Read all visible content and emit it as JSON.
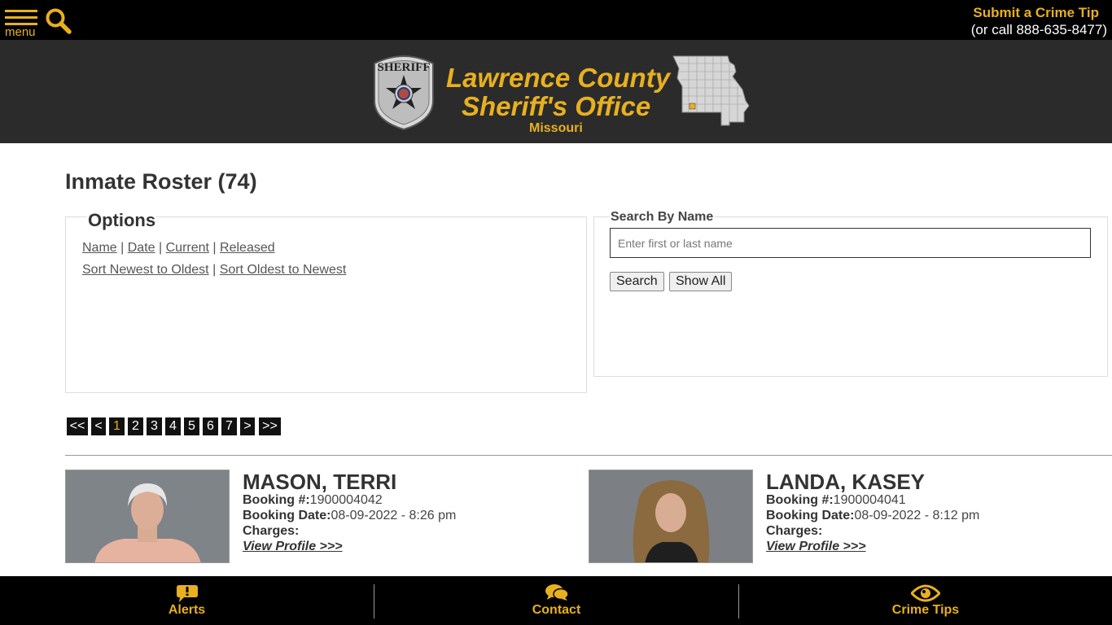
{
  "header": {
    "menu_label": "menu",
    "tip_title": "Submit a Crime Tip",
    "tip_phone": "(or call 888-635-8477)"
  },
  "banner": {
    "badge_text": "SHERIFF",
    "line1": "Lawrence County",
    "line2": "Sheriff's Office",
    "state": "Missouri"
  },
  "page": {
    "title": "Inmate Roster (74)"
  },
  "options": {
    "legend": "Options",
    "sort_links": [
      "Name",
      "Date",
      "Current",
      "Released"
    ],
    "order_links": [
      "Sort Newest to Oldest",
      "Sort Oldest to Newest"
    ],
    "separator": "|"
  },
  "search": {
    "legend": "Search By Name",
    "placeholder": "Enter first or last name",
    "search_button": "Search",
    "show_all_button": "Show All"
  },
  "pagination": [
    "<<",
    "<",
    "1",
    "2",
    "3",
    "4",
    "5",
    "6",
    "7",
    ">",
    ">>"
  ],
  "pagination_active": "1",
  "inmates": [
    {
      "name": "MASON, TERRI",
      "booking_label": "Booking #:",
      "booking_no": "1900004042",
      "date_label": "Booking Date:",
      "booking_date": "08-09-2022 - 8:26 pm",
      "charges_label": "Charges:",
      "view_link": "View Profile >>>"
    },
    {
      "name": "LANDA, KASEY",
      "booking_label": "Booking #:",
      "booking_no": "1900004041",
      "date_label": "Booking Date:",
      "booking_date": "08-09-2022 - 8:12 pm",
      "charges_label": "Charges:",
      "view_link": "View Profile >>>"
    }
  ],
  "bottom_nav": {
    "alerts": "Alerts",
    "contact": "Contact",
    "crime_tips": "Crime Tips"
  },
  "colors": {
    "accent": "#e8b020",
    "topbar": "#000000",
    "banner": "#2b2b2b"
  }
}
